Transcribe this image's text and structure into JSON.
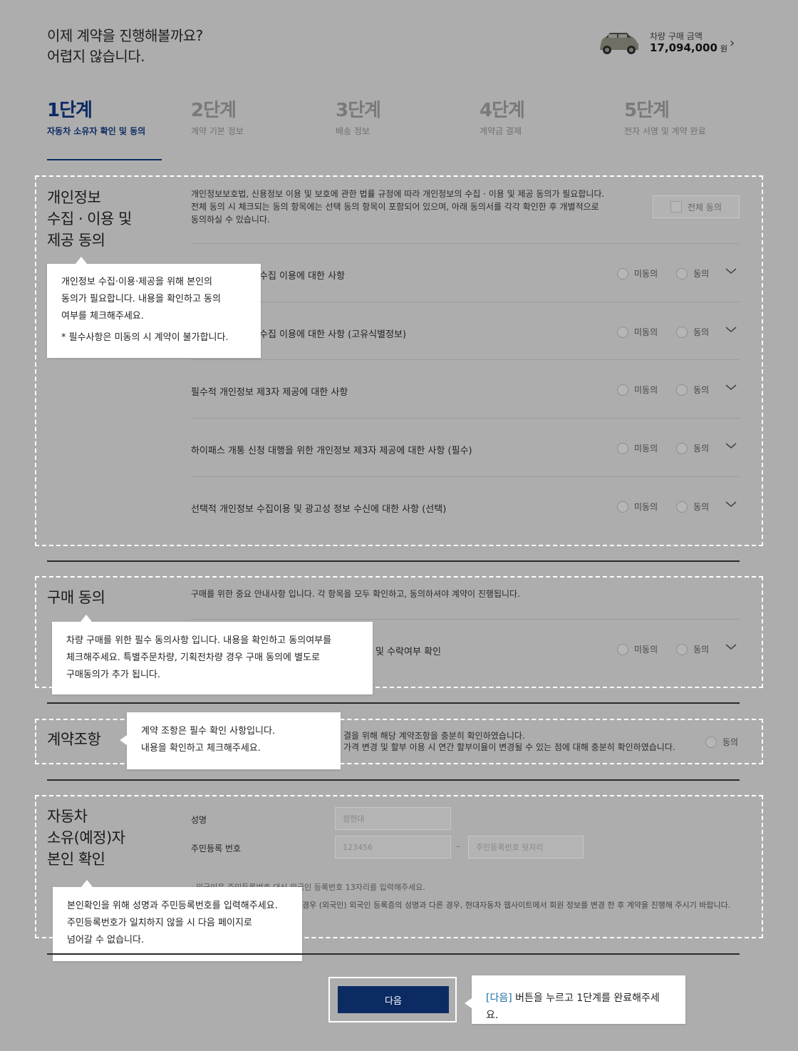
{
  "header": {
    "headline_line1": "이제 계약을 진행해볼까요?",
    "headline_line2": "어렵지 않습니다.",
    "car_price_label": "차량 구매 금액",
    "car_price": "17,094,000",
    "car_price_unit": "원"
  },
  "steps": [
    {
      "num": "1단계",
      "label": "자동차 소유자 확인 및 동의",
      "active": true
    },
    {
      "num": "2단계",
      "label": "계약 기본 정보"
    },
    {
      "num": "3단계",
      "label": "배송 정보"
    },
    {
      "num": "4단계",
      "label": "계약금 결제"
    },
    {
      "num": "5단계",
      "label": "전자 서명 및 계약 완료"
    }
  ],
  "privacy": {
    "title_l1": "개인정보",
    "title_l2": "수집 · 이용 및",
    "title_l3": "제공 동의",
    "desc_l1": "개인정보보호법, 신용정보 이용 및 보호에 관한 법률 규정에 따라 개인정보의 수집 · 이용 및 제공 동의가 필요합니다.",
    "desc_l2": "전체 동의 시 체크되는 동의 항목에는 선택 동의 항목이 포함되어 있으며, 아래 동의서를 각각 확인한 후 개별적으로",
    "desc_l3": "동의하실 수 있습니다.",
    "all_agree": "전체 동의",
    "rows": [
      "수집 이용에 대한 사항",
      "수집 이용에 대한 사항 (고유식별정보)",
      "필수적 개인정보 제3자 제공에 대한 사항",
      "하이패스 개통 신청 대행을 위한 개인정보 제3자 제공에 대한 사항 (필수)",
      "선택적 개인정보 수집이용 및 광고성 정보 수신에 대한 사항 (선택)"
    ],
    "tooltip_l1": "개인정보 수집·이용·제공을 위해 본인의",
    "tooltip_l2": "동의가 필요합니다. 내용을 확인하고 동의",
    "tooltip_l3": "여부를 체크해주세요.",
    "tooltip_note": "* 필수사항은 미동의 시 계약이 불가합니다."
  },
  "radio": {
    "disagree": "미동의",
    "agree": "동의"
  },
  "purchase": {
    "title": "구매 동의",
    "desc": "구매를 위한 중요 안내사항 입니다. 각 항목을 모두 확인하고, 동의하셔야 계약이 진행됩니다.",
    "row": "및 수락여부 확인",
    "tooltip_l1": "차량 구매를 위한 필수 동의사항 입니다. 내용을 확인하고 동의여부를",
    "tooltip_l2": "체크해주세요. 특별주문차량, 기획전차량 경우 구매 동의에 별도로",
    "tooltip_l3": "구매동의가 추가 됩니다."
  },
  "terms": {
    "title": "계약조항",
    "line1": "결을 위해 해당 계약조항을 충분히 확인하였습니다.",
    "line2": "가격 변경 및 할부 이용 시 연간 할부이율이 변경될 수 있는 점에 대해 충분히 확인하였습니다.",
    "agree": "동의",
    "tooltip_l1": "계약 조항은 필수 확인 사항입니다.",
    "tooltip_l2": "내용을 확인하고 체크해주세요."
  },
  "identity": {
    "title_l1": "자동차",
    "title_l2": "소유(예정)자",
    "title_l3": "본인 확인",
    "name_label": "성명",
    "name_value": "정현대",
    "rrn_label": "주민등록 번호",
    "rrn_front": "123456",
    "rrn_dash": "–",
    "rrn_back_placeholder": "주민등록번호 뒷자리",
    "note1": "· 외국인은 주민등록번호 대신 외국인 등록번호 13자리를 입력해주세요.",
    "note2": "경우 (외국인) 외국인 등록증의 성명과 다른 경우, 현대자동차 웹사이트에서 회원 정보를 변경 한 후 계약을 진행해 주시기 바랍니다.",
    "tooltip_l1": "본인확인을 위해 성명과 주민등록번호를 입력해주세요.",
    "tooltip_l2": "주민등록번호가 일치하지 않을 시 다음 페이지로",
    "tooltip_l3": "넘어갈 수 없습니다."
  },
  "next": {
    "button": "다음",
    "tip_highlight": "[다음]",
    "tip_rest": " 버튼을 누르고 1단계를 완료해주세요."
  },
  "colors": {
    "brand_navy": "#0c2b63",
    "overlay_gray": "#adadad",
    "tooltip_link": "#1f6fa5"
  }
}
